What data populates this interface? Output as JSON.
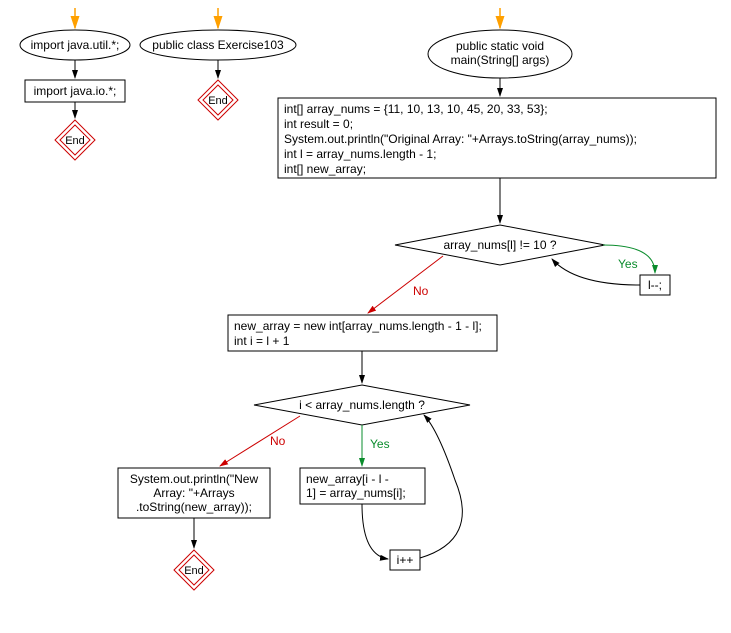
{
  "nodes": {
    "import_util": "import java.util.*;",
    "import_io": "import java.io.*;",
    "end1": "End",
    "class_decl": "public class Exercise103",
    "end2": "End",
    "main_decl_l1": "public static void",
    "main_decl_l2": "main(String[] args)",
    "init_l1": "int[] array_nums = {11, 10, 13, 10, 45, 20, 33, 53};",
    "init_l2": "int result = 0;",
    "init_l3": "System.out.println(\"Original Array: \"+Arrays.toString(array_nums));",
    "init_l4": "int l = array_nums.length - 1;",
    "init_l5": "int[] new_array;",
    "cond1": "array_nums[l] != 10 ?",
    "ldec": "l--;",
    "newarr_l1": "new_array = new int[array_nums.length - 1 - l];",
    "newarr_l2": "int i = l + 1",
    "cond2": "i < array_nums.length ?",
    "print_l1": "System.out.println(\"New",
    "print_l2": "Array: \"+Arrays",
    "print_l3": ".toString(new_array));",
    "assign_l1": "new_array[i - l -",
    "assign_l2": "1] = array_nums[i];",
    "iinc": "i++",
    "end3": "End",
    "yes": "Yes",
    "no": "No"
  }
}
